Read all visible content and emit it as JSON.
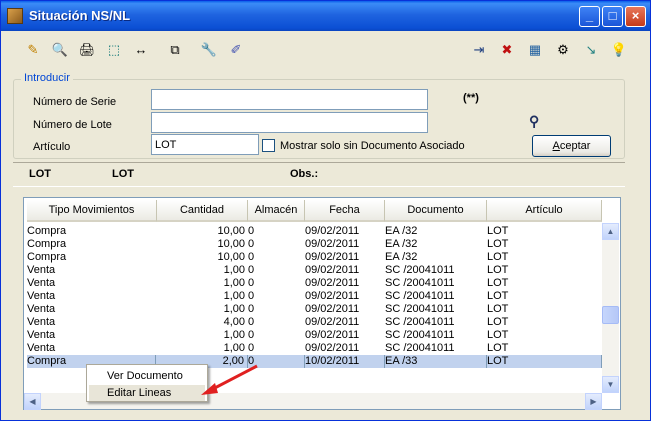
{
  "window": {
    "title": "Situación NS/NL",
    "controls": [
      "_",
      "□",
      "×"
    ]
  },
  "toolbar": {
    "left_icons": [
      "✎",
      "🔍",
      "🖨",
      "⬚",
      "↔",
      "⧉",
      "🔧",
      "✐"
    ],
    "right_icons": [
      "⇥",
      "✖",
      "▦",
      "⚙",
      "↘",
      "💡"
    ]
  },
  "filters": {
    "group_title": "Introducir",
    "serie_label": "Número de Serie",
    "serie_value": "",
    "lote_label": "Número de Lote",
    "lote_value": "",
    "articulo_label": "Artículo",
    "articulo_value": "LOT",
    "checkbox_label": "Mostrar solo sin Documento Asociado",
    "marker": "(**)",
    "binoculars": "⚲",
    "accept_label_pre": "",
    "accept_label_underline": "A",
    "accept_label_post": "ceptar"
  },
  "info": {
    "left": "LOT",
    "mid": "LOT",
    "obs_label": "Obs.:"
  },
  "table": {
    "headers": [
      "Tipo Movimientos",
      "Cantidad",
      "Almacén",
      "Fecha",
      "Documento",
      "Artículo"
    ],
    "rows": [
      [
        "Compra",
        "10,00",
        "0",
        "09/02/2011",
        "EA /32",
        "LOT"
      ],
      [
        "Compra",
        "10,00",
        "0",
        "09/02/2011",
        "EA /32",
        "LOT"
      ],
      [
        "Compra",
        "10,00",
        "0",
        "09/02/2011",
        "EA /32",
        "LOT"
      ],
      [
        "Venta",
        "1,00",
        "0",
        "09/02/2011",
        "SC /20041011",
        "LOT"
      ],
      [
        "Venta",
        "1,00",
        "0",
        "09/02/2011",
        "SC /20041011",
        "LOT"
      ],
      [
        "Venta",
        "1,00",
        "0",
        "09/02/2011",
        "SC /20041011",
        "LOT"
      ],
      [
        "Venta",
        "1,00",
        "0",
        "09/02/2011",
        "SC /20041011",
        "LOT"
      ],
      [
        "Venta",
        "4,00",
        "0",
        "09/02/2011",
        "SC /20041011",
        "LOT"
      ],
      [
        "Venta",
        "1,00",
        "0",
        "09/02/2011",
        "SC /20041011",
        "LOT"
      ],
      [
        "Venta",
        "1,00",
        "0",
        "09/02/2011",
        "SC /20041011",
        "LOT"
      ],
      [
        "Compra",
        "2,00",
        "0",
        "10/02/2011",
        "EA /33",
        "LOT"
      ]
    ],
    "selected_row": 10
  },
  "context_menu": {
    "items": [
      "Ver Documento",
      "Editar Lineas"
    ],
    "hovered": 1
  },
  "colors": {
    "title_bar": "#0A5FEA",
    "group_title": "#0046D5",
    "selection": "#C1D2EE",
    "arrow": "#E02020"
  }
}
